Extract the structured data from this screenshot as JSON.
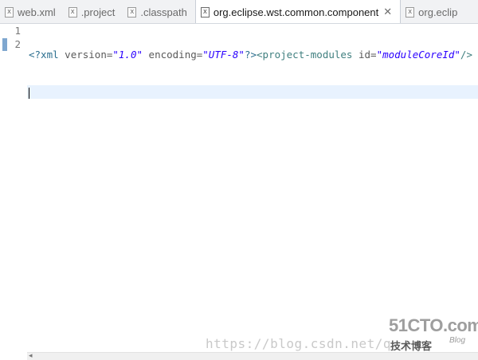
{
  "tabs": [
    {
      "label": "web.xml",
      "icon": "xml-file-icon",
      "active": false
    },
    {
      "label": ".project",
      "icon": "xml-file-icon",
      "active": false
    },
    {
      "label": ".classpath",
      "icon": "xml-file-icon",
      "active": false
    },
    {
      "label": "org.eclipse.wst.common.component",
      "icon": "xml-file-icon",
      "active": true,
      "close_glyph": "✕"
    },
    {
      "label": "org.eclip",
      "icon": "xml-file-icon",
      "active": false
    }
  ],
  "file_icon_glyph": "X",
  "editor": {
    "line_numbers": [
      "1",
      "2"
    ],
    "current_line": 2,
    "line1": {
      "pi_open": "<?xml",
      "attr1": " version=",
      "val1": "\"1.0\"",
      "attr2": " encoding=",
      "val2": "\"UTF-8\"",
      "pi_close": "?>",
      "tag_open": "<project-modules",
      "attr3": " id=",
      "val3": "\"moduleCoreId\"",
      "tag_close": "/>"
    }
  },
  "scrollbar": {
    "left_arrow": "◂"
  },
  "watermark": {
    "url": "https://blog.csdn.net/q",
    "logo_main": "51CTO.com",
    "logo_sub": "技术博客",
    "logo_blog": "Blog"
  },
  "colors": {
    "active_line": "#e8f2fe",
    "string": "#2a00ff",
    "tag": "#3f7f7f",
    "marker": "#7fa7cf"
  }
}
